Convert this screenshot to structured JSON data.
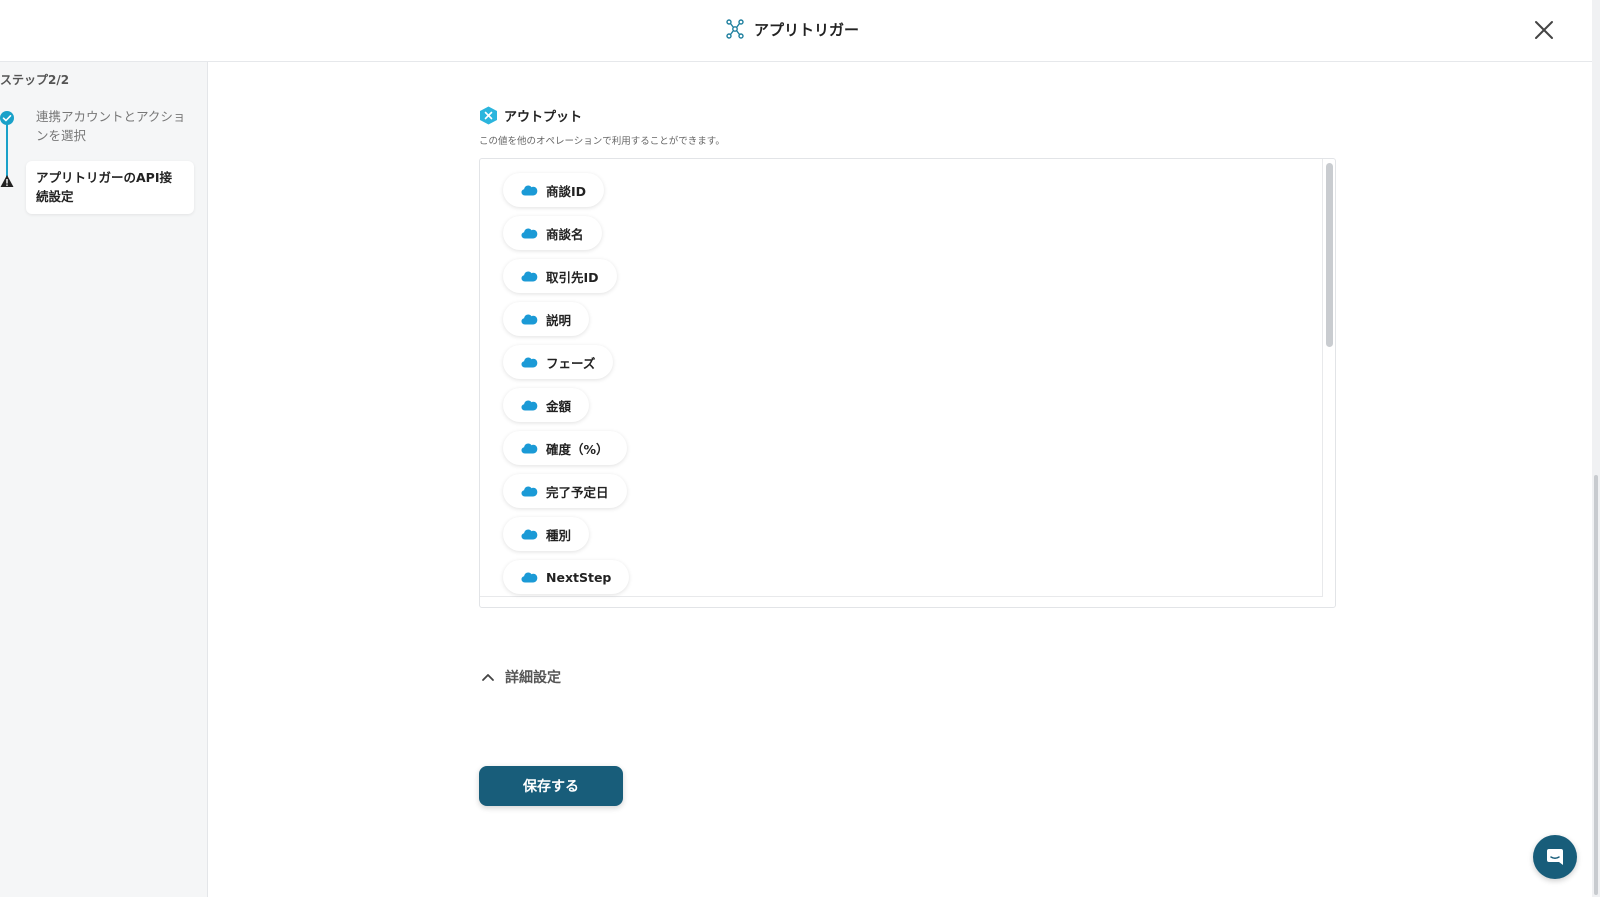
{
  "header": {
    "title": "アプリトリガー",
    "icon": "app-trigger-icon",
    "close_icon": "close-icon"
  },
  "sidebar": {
    "step_count": "ステップ2/2",
    "steps": [
      {
        "label": "連携アカウントとアクションを選択",
        "status": "completed"
      },
      {
        "label": "アプリトリガーのAPI接続設定",
        "status": "warning",
        "active": true
      }
    ]
  },
  "output": {
    "title": "アウトプット",
    "description": "この値を他のオペレーションで利用することができます。",
    "items": [
      {
        "label": "商談ID"
      },
      {
        "label": "商談名"
      },
      {
        "label": "取引先ID"
      },
      {
        "label": "説明"
      },
      {
        "label": "フェーズ"
      },
      {
        "label": "金額"
      },
      {
        "label": "確度（%）"
      },
      {
        "label": "完了予定日"
      },
      {
        "label": "種別"
      },
      {
        "label": "NextStep"
      }
    ]
  },
  "advanced": {
    "label": "詳細設定"
  },
  "actions": {
    "save_label": "保存する"
  },
  "colors": {
    "accent": "#185d7a",
    "step_line": "#1aa1c9",
    "salesforce_blue": "#1b9ad6",
    "output_badge": "#2bb5dd"
  }
}
